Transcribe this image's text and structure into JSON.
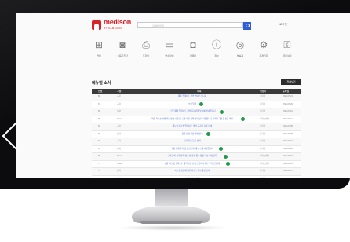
{
  "header": {
    "brand": "medison",
    "brand_sub": "BY SAMSUNG",
    "search_placeholder": "검색어 입력",
    "login_label": "로그인"
  },
  "quick_icons": [
    {
      "name": "grid-icon",
      "glyph": "⊞",
      "label": "전체"
    },
    {
      "name": "camera-icon",
      "glyph": "◙",
      "label": "초음파진단"
    },
    {
      "name": "printer-icon",
      "glyph": "⎙",
      "label": "프린터"
    },
    {
      "name": "monitor-icon",
      "glyph": "▭",
      "label": "영상장비"
    },
    {
      "name": "photo-icon",
      "glyph": "◘",
      "label": "카메라"
    },
    {
      "name": "info-icon",
      "glyph": "ⓘ",
      "label": "정보"
    },
    {
      "name": "disc-icon",
      "glyph": "◎",
      "label": "부속품"
    },
    {
      "name": "gear-icon",
      "glyph": "⚙",
      "label": "원격진단"
    },
    {
      "name": "key-icon",
      "glyph": "⚿",
      "label": "관리설정"
    }
  ],
  "section": {
    "title": "메뉴얼 소식",
    "more_label": "전체보기"
  },
  "table": {
    "columns": [
      "번호",
      "구분",
      "제목",
      "작성자",
      "등록일"
    ],
    "rows": [
      {
        "no": "88",
        "cat": "공지",
        "title": "제품 업데이트 관련 안내 드립니다",
        "author": "관리자",
        "date": "2021.07.21",
        "dot": false
      },
      {
        "no": "87",
        "cat": "공지",
        "title": "소식 알림",
        "author": "관리자",
        "date": "2021.07.20",
        "dot": true
      },
      {
        "no": "86",
        "cat": "안내",
        "title": "소프트웨어 업데이트 관련 공지사항 및 설치 안내입니다",
        "author": "관리자",
        "date": "2021.07.16",
        "dot": true
      },
      {
        "no": "85",
        "cat": "Notice",
        "title": "제품 서비스 관련 주요 변경 사항 및 고객 지원 정책 안내 공지사항입니다 자세한 내용은 본문 확인",
        "author": "서비스센터",
        "date": "2021.07.12",
        "dot": true
      },
      {
        "no": "84",
        "cat": "공지",
        "title": "메뉴얼 자료실 업데이트 및 신규 자료 등록 안내",
        "author": "관리자",
        "date": "2021.07.09",
        "dot": false
      },
      {
        "no": "83",
        "cat": "안내",
        "title": "장비 점검 일정 관련 안내",
        "author": "관리자",
        "date": "2021.07.05",
        "dot": true
      },
      {
        "no": "82",
        "cat": "공지",
        "title": "교육 자료 등록 안내",
        "author": "관리자",
        "date": "2021.07.01",
        "dot": false
      },
      {
        "no": "81",
        "cat": "안내",
        "title": "부품 교체 주기 및 점검 관련 세부 안내 사항입니다",
        "author": "관리자",
        "date": "2021.06.28",
        "dot": true
      },
      {
        "no": "80",
        "cat": "Notice",
        "title": "고객 문의 처리 절차 변경 안내 및 접수 방법 개선 사항 공지",
        "author": "서비스센터",
        "date": "2021.06.24",
        "dot": true
      },
      {
        "no": "79",
        "cat": "Notice",
        "title": "보증 기간 및 유지보수 계약 관련 안내 드립니다 확인 부탁드립니다",
        "author": "서비스센터",
        "date": "2021.06.21",
        "dot": true
      },
      {
        "no": "78",
        "cat": "공지",
        "title": "시스템 점검에 따른 서비스 일시 중단 안내",
        "author": "관리자",
        "date": "2021.06.17",
        "dot": false
      },
      {
        "no": "77",
        "cat": "안내",
        "title": "신규 기능 소개",
        "author": "관리자",
        "date": "2021.06.14",
        "dot": false
      }
    ]
  }
}
